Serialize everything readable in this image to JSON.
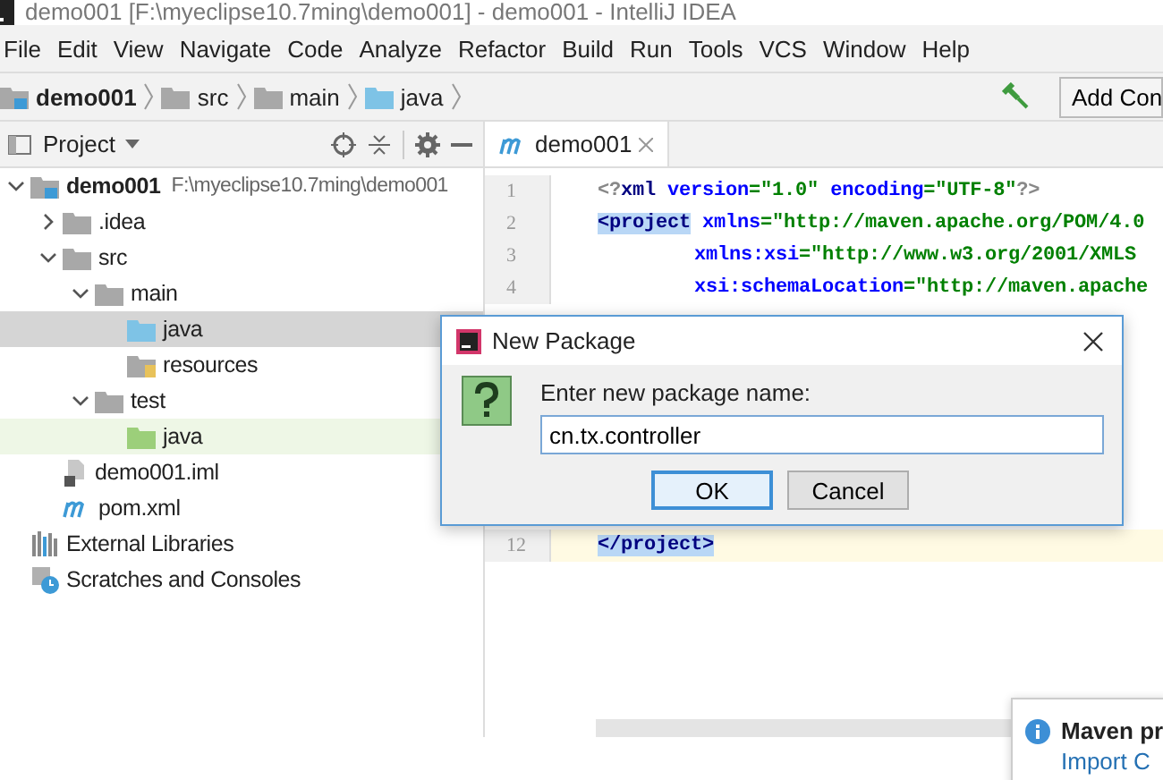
{
  "window": {
    "title": "demo001 [F:\\myeclipse10.7ming\\demo001] - demo001 - IntelliJ IDEA"
  },
  "menu": [
    "File",
    "Edit",
    "View",
    "Navigate",
    "Code",
    "Analyze",
    "Refactor",
    "Build",
    "Run",
    "Tools",
    "VCS",
    "Window",
    "Help"
  ],
  "breadcrumb": [
    {
      "label": "demo001",
      "kind": "module"
    },
    {
      "label": "src",
      "kind": "folder"
    },
    {
      "label": "main",
      "kind": "folder"
    },
    {
      "label": "java",
      "kind": "source"
    }
  ],
  "toolbar": {
    "button": "Add Con"
  },
  "project_panel": {
    "title": "Project",
    "tree": [
      {
        "label": "demo001",
        "detail": "F:\\myeclipse10.7ming\\demo001",
        "kind": "module",
        "expanded": true,
        "selected": false,
        "highlighted": false,
        "children": [
          {
            "label": ".idea",
            "kind": "folder",
            "expanded": false,
            "selected": false,
            "highlighted": false
          },
          {
            "label": "src",
            "kind": "folder",
            "expanded": true,
            "selected": false,
            "highlighted": false,
            "children": [
              {
                "label": "main",
                "kind": "folder",
                "expanded": true,
                "selected": false,
                "highlighted": false,
                "children": [
                  {
                    "label": "java",
                    "kind": "source",
                    "selected": true,
                    "highlighted": false
                  },
                  {
                    "label": "resources",
                    "kind": "resources",
                    "selected": false,
                    "highlighted": false
                  }
                ]
              },
              {
                "label": "test",
                "kind": "folder",
                "expanded": true,
                "selected": false,
                "highlighted": false,
                "children": [
                  {
                    "label": "java",
                    "kind": "test",
                    "selected": false,
                    "highlighted": true
                  }
                ]
              }
            ]
          },
          {
            "label": "demo001.iml",
            "kind": "iml",
            "selected": false,
            "highlighted": false
          },
          {
            "label": "pom.xml",
            "kind": "maven",
            "selected": false,
            "highlighted": false
          }
        ]
      },
      {
        "label": "External Libraries",
        "kind": "libraries",
        "selected": false,
        "highlighted": false
      },
      {
        "label": "Scratches and Consoles",
        "kind": "scratches",
        "selected": false,
        "highlighted": false
      }
    ]
  },
  "editor": {
    "tab": {
      "label": "demo001",
      "selected": true
    },
    "lines": [
      {
        "number": "1",
        "current": false,
        "indented": false,
        "segments": [
          {
            "kind": "punct",
            "text": "<?"
          },
          {
            "kind": "tag",
            "text": "xml"
          },
          {
            "kind": "attr",
            "text": " version"
          },
          {
            "kind": "value",
            "text": "=\"1.0\""
          },
          {
            "kind": "attr",
            "text": " encoding"
          },
          {
            "kind": "value",
            "text": "=\"UTF-8\""
          },
          {
            "kind": "punct",
            "text": "?>"
          }
        ]
      },
      {
        "number": "2",
        "current": false,
        "indented": false,
        "segments": [
          {
            "kind": "tag",
            "text": "<project",
            "match": true
          },
          {
            "kind": "attr",
            "text": " xmlns"
          },
          {
            "kind": "value",
            "text": "=\"http://maven.apache.org/POM/4.0"
          }
        ]
      },
      {
        "number": "3",
        "current": false,
        "indented": true,
        "segments": [
          {
            "kind": "attr",
            "text": "xmlns:xsi"
          },
          {
            "kind": "value",
            "text": "=\"http://www.w3.org/2001/XMLS"
          }
        ]
      },
      {
        "number": "4",
        "current": false,
        "indented": true,
        "segments": [
          {
            "kind": "attr",
            "text": "xsi:schemaLocation"
          },
          {
            "kind": "value",
            "text": "=\"http://maven.apache"
          }
        ]
      },
      {
        "number": "12",
        "current": true,
        "indented": false,
        "segments": [
          {
            "kind": "tag",
            "text": "</project>",
            "match": true
          }
        ]
      }
    ]
  },
  "dialog": {
    "title": "New Package",
    "prompt": "Enter new package name:",
    "value": "cn.tx.controller",
    "buttons": [
      {
        "label": "OK",
        "default": true
      },
      {
        "label": "Cancel",
        "default": false
      }
    ]
  },
  "notification": {
    "title": "Maven pr",
    "link": "Import C"
  }
}
